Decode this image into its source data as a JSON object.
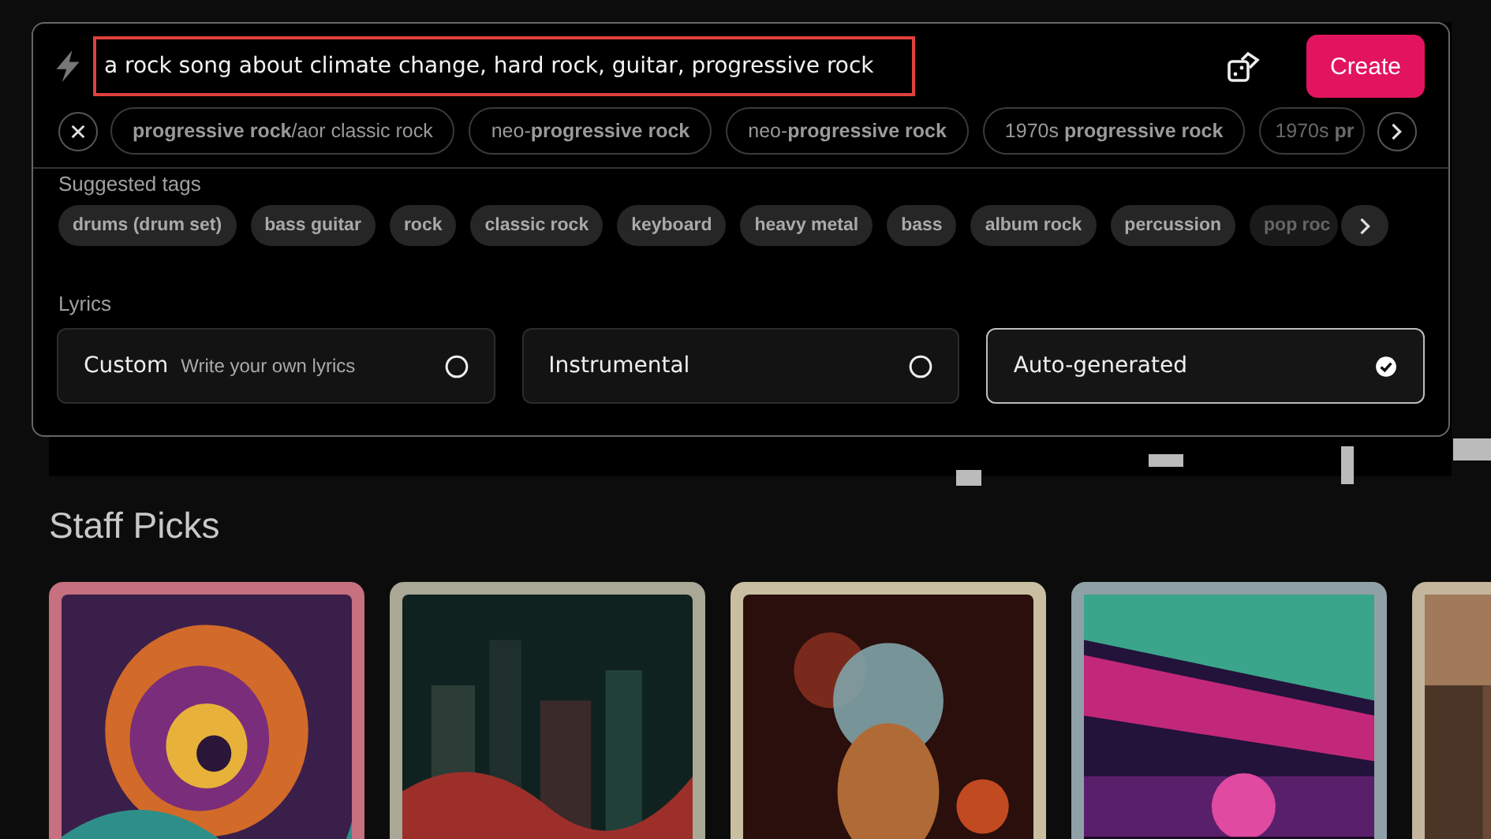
{
  "prompt": {
    "value": "a rock song about climate change, hard rock, guitar, progressive rock"
  },
  "create_button": "Create",
  "suggestions": [
    {
      "text": "**progressive rock**/aor classic rock"
    },
    {
      "text": "neo-**progressive rock**"
    },
    {
      "text": "neo-**progressive rock**"
    },
    {
      "text": "1970s **progressive rock**"
    },
    {
      "text": "1970s **pr**"
    }
  ],
  "suggested_tags": {
    "label": "Suggested tags",
    "tags": [
      "drums (drum set)",
      "bass guitar",
      "rock",
      "classic rock",
      "keyboard",
      "heavy metal",
      "bass",
      "album rock",
      "percussion",
      "pop roc"
    ]
  },
  "lyrics": {
    "label": "Lyrics",
    "options": [
      {
        "label": "Custom",
        "hint": "Write your own lyrics",
        "selected": false
      },
      {
        "label": "Instrumental",
        "selected": false
      },
      {
        "label": "Auto-generated",
        "selected": true
      }
    ]
  },
  "staff_picks": {
    "title": "Staff Picks"
  }
}
